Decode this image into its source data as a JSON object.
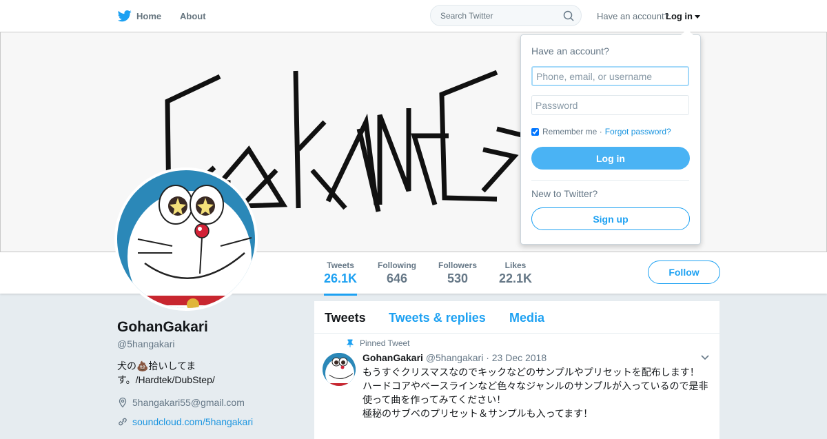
{
  "colors": {
    "brand": "#1da1f2",
    "background": "#e6ecf0",
    "text_secondary": "#657786"
  },
  "nav": {
    "home": "Home",
    "about": "About",
    "search_placeholder": "Search Twitter",
    "have_account": "Have an account?",
    "login": "Log in"
  },
  "banner": {
    "logo_text": "GohanGakari"
  },
  "stats": [
    {
      "label": "Tweets",
      "value": "26.1K"
    },
    {
      "label": "Following",
      "value": "646"
    },
    {
      "label": "Followers",
      "value": "530"
    },
    {
      "label": "Likes",
      "value": "22.1K"
    }
  ],
  "follow_button": "Follow",
  "profile": {
    "name": "GohanGakari",
    "handle": "@5hangakari",
    "bio": "犬の💩拾いしてます。/Hardtek/DubStep/",
    "email": "5hangakari55@gmail.com",
    "link": "soundcloud.com/5hangakari"
  },
  "timeline": {
    "tabs": [
      "Tweets",
      "Tweets & replies",
      "Media"
    ],
    "pinned_label": "Pinned Tweet",
    "tweet": {
      "name": "GohanGakari",
      "meta": "@5hangakari · 23 Dec 2018",
      "text": "もうすぐクリスマスなのでキックなどのサンプルやプリセットを配布します！\nハードコアやベースラインなど色々なジャンルのサンプルが入っているので是非使って曲を作ってみてください！\n極秘のサブベのプリセット＆サンプルも入ってます！"
    }
  },
  "login_dropdown": {
    "title": "Have an account?",
    "username_placeholder": "Phone, email, or username",
    "password_placeholder": "Password",
    "remember": "Remember me ·",
    "forgot": "Forgot password?",
    "login_button": "Log in",
    "new_label": "New to Twitter?",
    "signup_button": "Sign up"
  }
}
